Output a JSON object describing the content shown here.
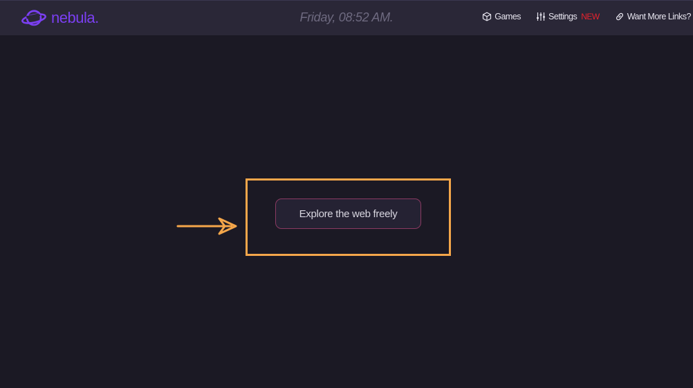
{
  "navbar": {
    "logo_text": "nebula.",
    "logo_icon": "planet-icon",
    "clock_text": "Friday, 08:52 AM.",
    "links": [
      {
        "label": "Games",
        "icon": "cube-icon"
      },
      {
        "label": "Settings",
        "icon": "sliders-icon",
        "badge": "NEW"
      },
      {
        "label": "Want More Links?",
        "icon": "link-icon"
      }
    ]
  },
  "main": {
    "cta_label": "Explore the web freely",
    "annotation": {
      "arrow_icon": "arrow-right-icon",
      "highlight_color": "#f4a64a"
    }
  },
  "colors": {
    "background": "#1b1924",
    "navbar": "#2a2737",
    "brand": "#7b3ff2",
    "badge": "#e8232d",
    "button_border": "#8a3a62"
  }
}
